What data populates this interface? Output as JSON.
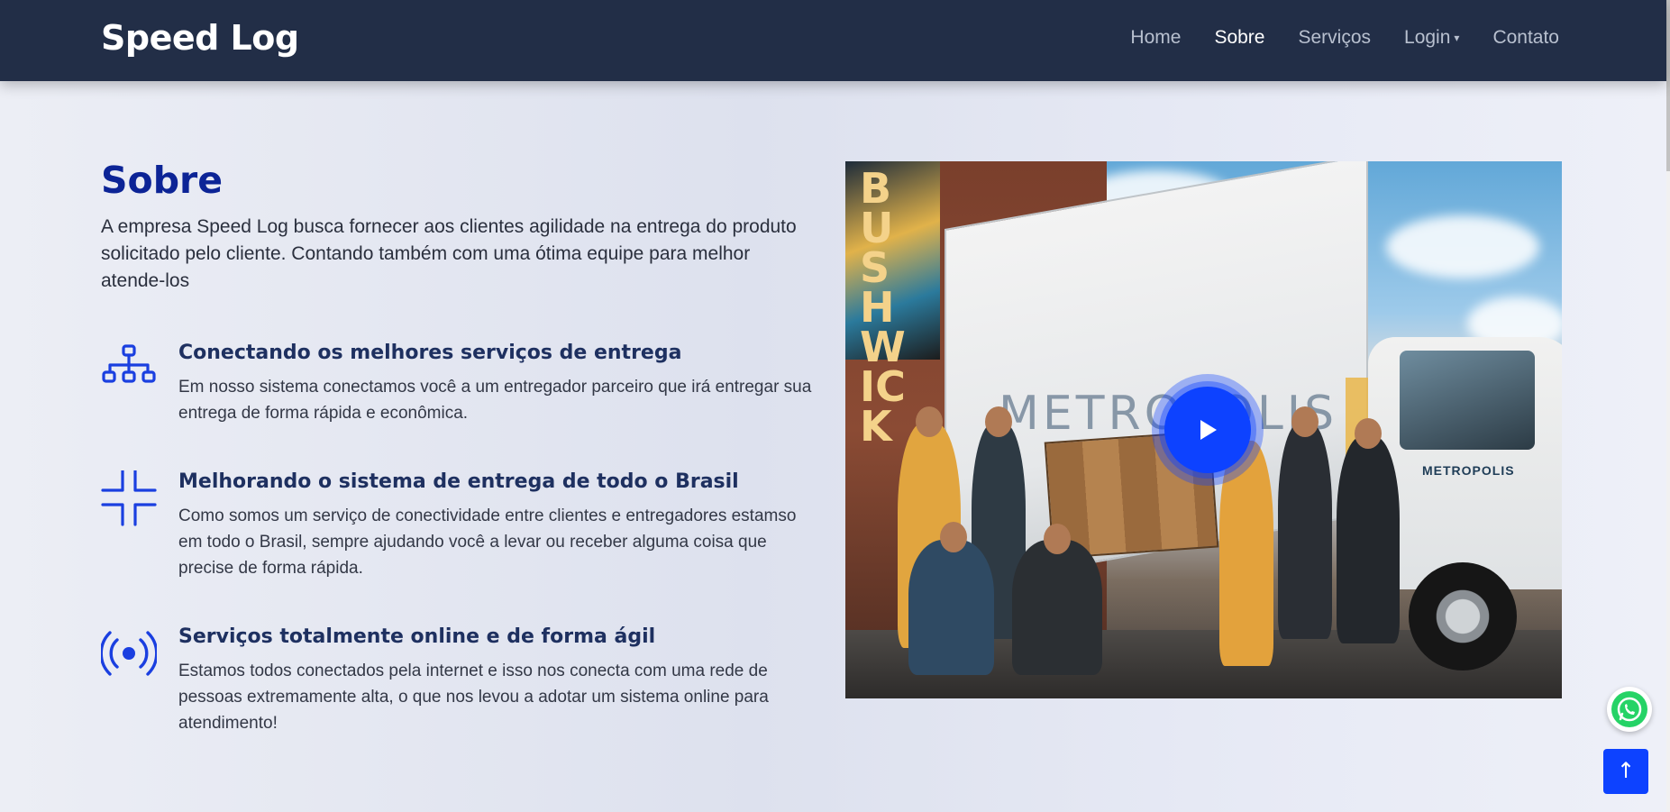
{
  "header": {
    "brand": "Speed Log",
    "nav": [
      {
        "label": "Home",
        "active": false
      },
      {
        "label": "Sobre",
        "active": true
      },
      {
        "label": "Serviços",
        "active": false
      },
      {
        "label": "Login",
        "active": false,
        "dropdown": true
      },
      {
        "label": "Contato",
        "active": false
      }
    ]
  },
  "about": {
    "title": "Sobre",
    "intro": "A empresa Speed Log busca fornecer aos clientes agilidade na entrega do produto solicitado pelo cliente. Contando também com uma ótima equipe para melhor atende-los",
    "features": [
      {
        "icon": "network-diagram-icon",
        "title": "Conectando os melhores serviços de entrega",
        "text": "Em nosso sistema conectamos você a um entregador parceiro que irá entregar sua entrega de forma rápida e econômica."
      },
      {
        "icon": "shrink-corners-icon",
        "title": "Melhorando o sistema de entrega de todo o Brasil",
        "text": "Como somos um serviço de conectividade entre clientes e entregadores estamso em todo o Brasil, sempre ajudando você a levar ou receber alguma coisa que precise de forma rápida."
      },
      {
        "icon": "broadcast-icon",
        "title": "Serviços totalmente online e de forma ágil",
        "text": "Estamos todos conectados pela internet e isso nos conecta com uma rede de pessoas extremamente alta, o que nos levou a adotar um sistema online para atendimento!"
      }
    ]
  },
  "video": {
    "image_subject": "moving crew posing in front of a Metropolis moving truck",
    "mural_text": "BUSHWICK",
    "truck_text": "METROPOLIS",
    "cab_text": "METROPOLIS"
  },
  "floating": {
    "back_to_top": "↑"
  },
  "colors": {
    "navbar": "#222e47",
    "accent": "#0d42ff",
    "title": "#0c2496",
    "whatsapp": "#25d366"
  }
}
